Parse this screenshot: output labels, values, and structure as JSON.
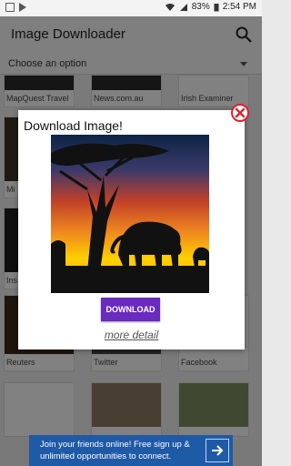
{
  "status_bar": {
    "battery": "83%",
    "time": "2:54 PM"
  },
  "app_bar": {
    "title": "Image Downloader",
    "search_icon": "search-icon"
  },
  "dropdown": {
    "value": "Choose an option"
  },
  "grid": {
    "row1": [
      "MapQuest Travel",
      "News.com.au",
      "Irish Examiner"
    ],
    "row_reuters": [
      "Reuters",
      "Twitter",
      "Facebook"
    ],
    "partial_left": [
      "Mi",
      "Ins"
    ]
  },
  "dialog": {
    "title": "Download Image!",
    "download_label": "DOWNLOAD",
    "more_detail": "more detail",
    "close_icon": "close-icon"
  },
  "ad": {
    "text": "Join your friends online! Free sign up & unlimited opportunities to connect."
  },
  "colors": {
    "accent": "#6a2bbf",
    "close": "#e0202d",
    "ad": "#1f5aa6"
  }
}
